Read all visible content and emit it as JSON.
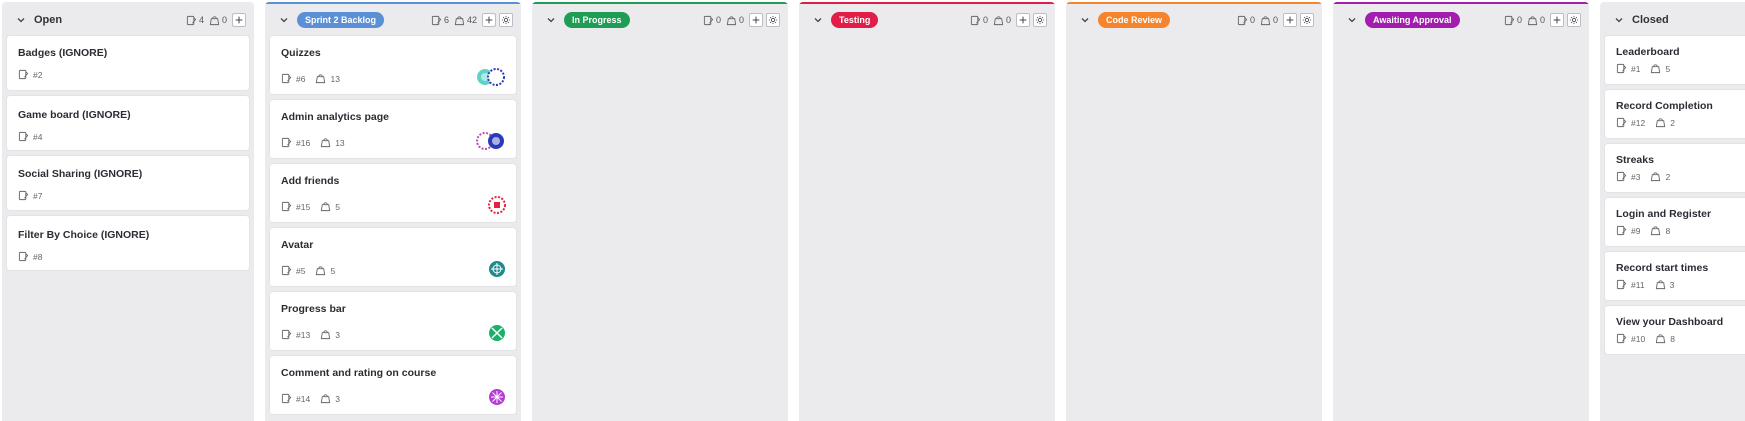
{
  "columns": {
    "open": {
      "title": "Open",
      "issues": "4",
      "points": "0",
      "cards": [
        {
          "title": "Badges (IGNORE)",
          "num": "#2"
        },
        {
          "title": "Game board (IGNORE)",
          "num": "#4"
        },
        {
          "title": "Social Sharing (IGNORE)",
          "num": "#7"
        },
        {
          "title": "Filter By Choice (IGNORE)",
          "num": "#8"
        }
      ]
    },
    "sprint": {
      "title": "Sprint 2 Backlog",
      "issues": "6",
      "points": "42",
      "accent": "#5b8fd6",
      "cards": [
        {
          "title": "Quizzes",
          "num": "#6",
          "points": "13"
        },
        {
          "title": "Admin analytics page",
          "num": "#16",
          "points": "13"
        },
        {
          "title": "Add friends",
          "num": "#15",
          "points": "5"
        },
        {
          "title": "Avatar",
          "num": "#5",
          "points": "5"
        },
        {
          "title": "Progress bar",
          "num": "#13",
          "points": "3"
        },
        {
          "title": "Comment and rating on course",
          "num": "#14",
          "points": "3"
        }
      ]
    },
    "inprogress": {
      "title": "In Progress",
      "issues": "0",
      "points": "0",
      "accent": "#1f9d55"
    },
    "testing": {
      "title": "Testing",
      "issues": "0",
      "points": "0",
      "accent": "#e11d48"
    },
    "codereview": {
      "title": "Code Review",
      "issues": "0",
      "points": "0",
      "accent": "#f5842c"
    },
    "awaiting": {
      "title": "Awaiting Approval",
      "issues": "0",
      "points": "0",
      "accent": "#a21caf"
    },
    "closed": {
      "title": "Closed",
      "cards": [
        {
          "title": "Leaderboard",
          "num": "#1",
          "points": "5"
        },
        {
          "title": "Record Completion",
          "num": "#12",
          "points": "2"
        },
        {
          "title": "Streaks",
          "num": "#3",
          "points": "2"
        },
        {
          "title": "Login and Register",
          "num": "#9",
          "points": "8"
        },
        {
          "title": "Record start times",
          "num": "#11",
          "points": "3"
        },
        {
          "title": "View your Dashboard",
          "num": "#10",
          "points": "8"
        }
      ]
    }
  },
  "icons": {
    "issue": "issue-icon",
    "weight": "weight-icon",
    "add": "plus-icon",
    "settings": "gear-icon",
    "collapse": "chevron-down-icon",
    "avatar": "identicon-avatar"
  }
}
